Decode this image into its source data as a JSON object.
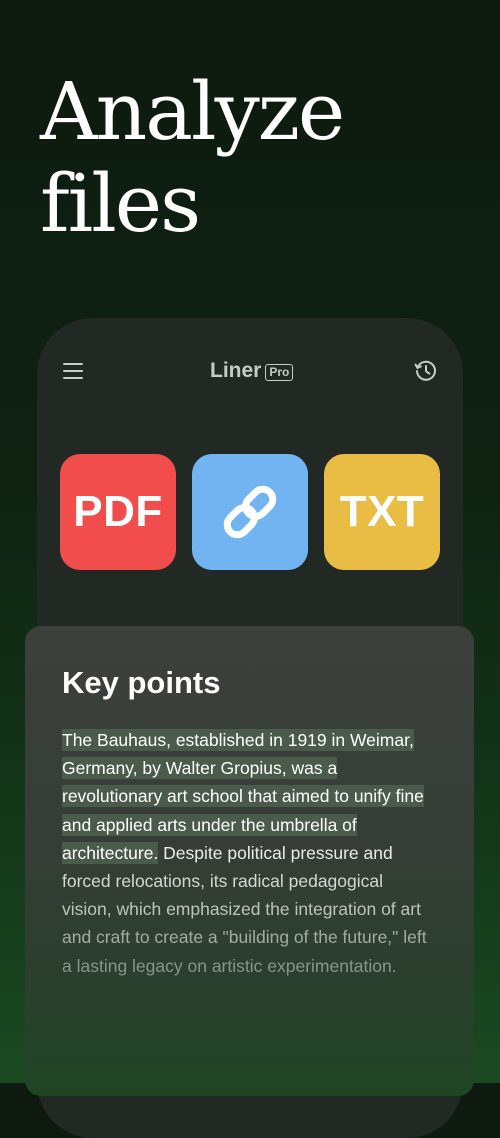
{
  "hero": {
    "title_line1": "Analyze",
    "title_line2": "files"
  },
  "app": {
    "brand_name": "Liner",
    "brand_badge": "Pro",
    "menu_icon": "hamburger-menu-icon",
    "history_icon": "history-clock-icon"
  },
  "tiles": {
    "pdf_label": "PDF",
    "link_icon": "link-chain-icon",
    "txt_label": "TXT",
    "colors": {
      "pdf": "#f14d4d",
      "link": "#72b4f2",
      "txt": "#e9bd44"
    }
  },
  "key_points": {
    "title": "Key points",
    "lines": [
      "The Bauhaus, established in 1919 in Weimar,",
      "Germany, by Walter Gropius, was a",
      "revolutionary art school that aimed to unify fine",
      "and applied arts under the umbrella of",
      "architecture.",
      " Despite political pressure and",
      "forced relocations, its radical pedagogical",
      "vision, which emphasized the integration of art",
      "and craft to create a \"building of the future,\" left",
      "a lasting legacy on artistic experimentation."
    ]
  }
}
